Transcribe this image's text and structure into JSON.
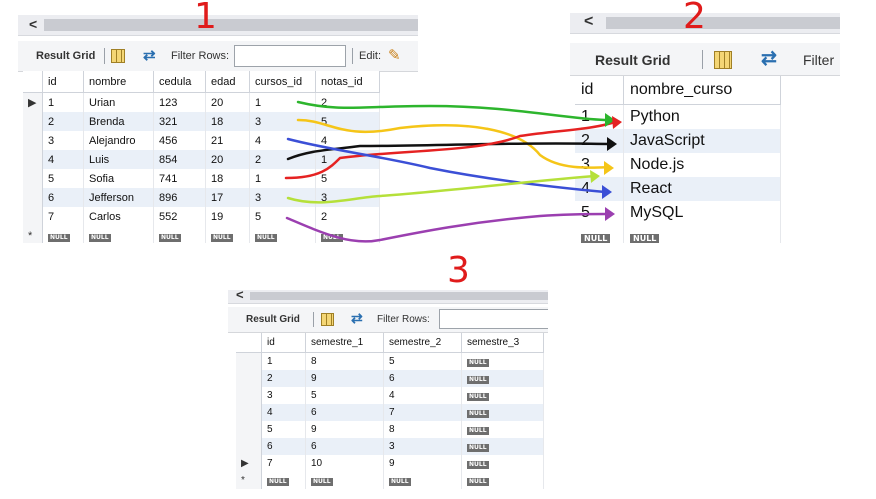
{
  "panels": {
    "alumnos": {
      "toolbar": {
        "result_grid": "Result Grid",
        "filter_rows": "Filter Rows:",
        "edit": "Edit:"
      },
      "columns": [
        "id",
        "nombre",
        "cedula",
        "edad",
        "cursos_id",
        "notas_id"
      ],
      "rows": [
        [
          "1",
          "Urian",
          "123",
          "20",
          "1",
          "2"
        ],
        [
          "2",
          "Brenda",
          "321",
          "18",
          "3",
          "5"
        ],
        [
          "3",
          "Alejandro",
          "456",
          "21",
          "4",
          "4"
        ],
        [
          "4",
          "Luis",
          "854",
          "20",
          "2",
          "1"
        ],
        [
          "5",
          "Sofia",
          "741",
          "18",
          "1",
          "5"
        ],
        [
          "6",
          "Jefferson",
          "896",
          "17",
          "3",
          "3"
        ],
        [
          "7",
          "Carlos",
          "552",
          "19",
          "5",
          "2"
        ]
      ],
      "null_label": "NULL",
      "new_row_marker": "*",
      "current_row_marker": "▶"
    },
    "cursos": {
      "toolbar": {
        "result_grid": "Result Grid",
        "filter_rows": "Filter"
      },
      "columns": [
        "id",
        "nombre_curso"
      ],
      "rows": [
        [
          "1",
          "Python"
        ],
        [
          "2",
          "JavaScript"
        ],
        [
          "3",
          "Node.js"
        ],
        [
          "4",
          "React"
        ],
        [
          "5",
          "MySQL"
        ]
      ],
      "null_label": "NULL"
    },
    "notas": {
      "toolbar": {
        "result_grid": "Result Grid",
        "filter_rows": "Filter Rows:"
      },
      "columns": [
        "id",
        "semestre_1",
        "semestre_2",
        "semestre_3"
      ],
      "rows": [
        [
          "1",
          "8",
          "5",
          "NULL"
        ],
        [
          "2",
          "9",
          "6",
          "NULL"
        ],
        [
          "3",
          "5",
          "4",
          "NULL"
        ],
        [
          "4",
          "6",
          "7",
          "NULL"
        ],
        [
          "5",
          "9",
          "8",
          "NULL"
        ],
        [
          "6",
          "6",
          "3",
          "NULL"
        ],
        [
          "7",
          "10",
          "9",
          "NULL"
        ]
      ],
      "null_label": "NULL",
      "new_row_marker": "*",
      "current_row_marker": "▶"
    }
  },
  "annotations": {
    "label_1": "1",
    "label_2": "2",
    "label_3": "3"
  },
  "arrow_colors": [
    "#2db52d",
    "#f5c518",
    "#111111",
    "#e52222",
    "#3b4fd6",
    "#b5e03a",
    "#9b3fb0"
  ]
}
